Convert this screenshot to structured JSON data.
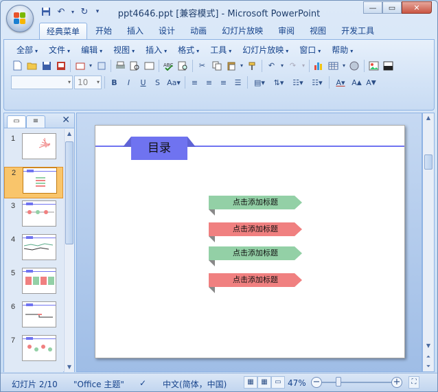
{
  "window": {
    "title": "ppt4646.ppt [兼容模式] - Microsoft PowerPoint",
    "controls": {
      "minimize": "—",
      "maximize": "▭",
      "close": "✕"
    }
  },
  "quick_access": [
    "save-icon",
    "undo-icon",
    "redo-icon",
    "customize-icon"
  ],
  "ribbon_tabs": [
    "经典菜单",
    "开始",
    "插入",
    "设计",
    "动画",
    "幻灯片放映",
    "审阅",
    "视图",
    "开发工具"
  ],
  "active_tab": "经典菜单",
  "menus": [
    "全部",
    "文件",
    "编辑",
    "视图",
    "插入",
    "格式",
    "工具",
    "幻灯片放映",
    "窗口",
    "帮助"
  ],
  "font_box": {
    "font": "",
    "size": "10"
  },
  "slide_panel": {
    "tab_slides": "▭",
    "tab_outline": "≡",
    "close": "✕",
    "slides": [
      {
        "num": "1"
      },
      {
        "num": "2"
      },
      {
        "num": "3"
      },
      {
        "num": "4"
      },
      {
        "num": "5"
      },
      {
        "num": "6"
      },
      {
        "num": "7"
      }
    ],
    "selected": 2
  },
  "slide": {
    "title": "目录",
    "items": [
      {
        "text": "点击添加标题",
        "color": "#93d0a6"
      },
      {
        "text": "点击添加标题",
        "color": "#f08080"
      },
      {
        "text": "点击添加标题",
        "color": "#93d0a6"
      },
      {
        "text": "点击添加标题",
        "color": "#f08080"
      }
    ],
    "accent": "#6f73f0"
  },
  "status": {
    "slide_info": "幻灯片 2/10",
    "theme": "\"Office 主题\"",
    "language": "中文(简体，中国)",
    "zoom": "47%",
    "zoom_level": 0.47
  }
}
